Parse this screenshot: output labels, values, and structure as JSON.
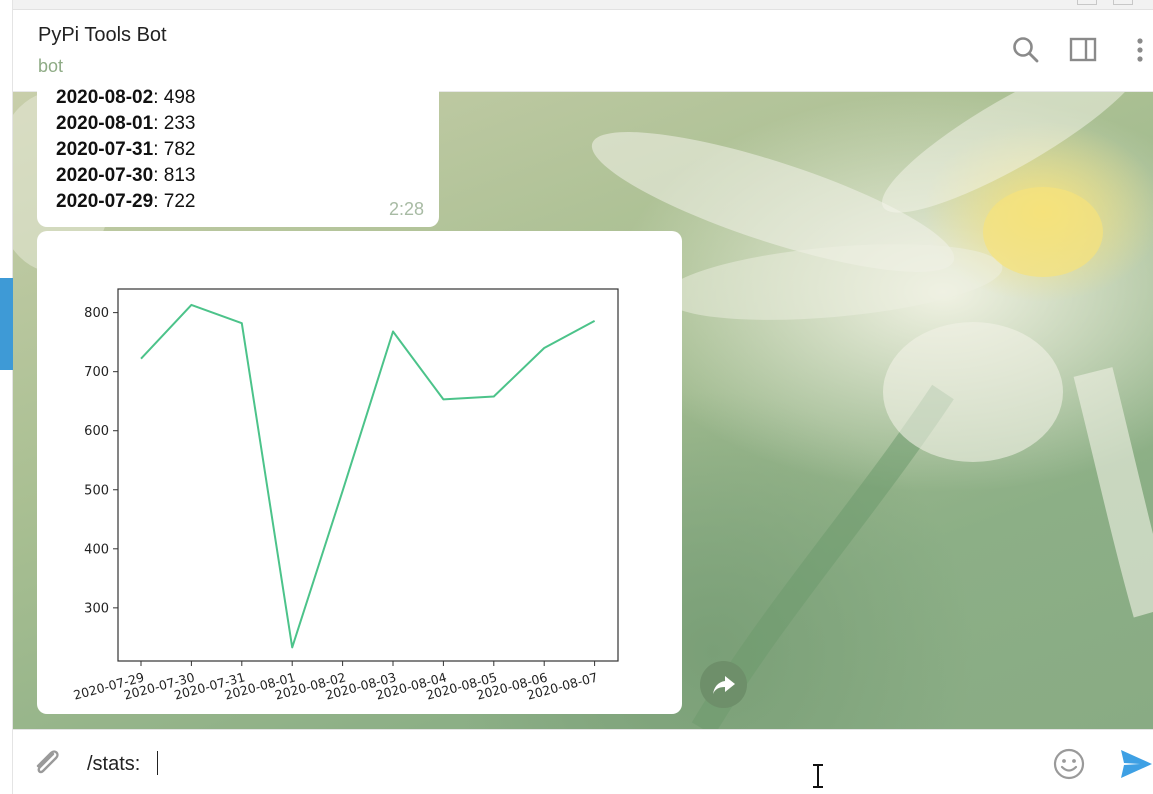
{
  "header": {
    "title": "PyPi Tools Bot",
    "subtitle": "bot",
    "icons": [
      "search-icon",
      "sidebar-toggle-icon",
      "more-vertical-icon"
    ]
  },
  "stats_message": {
    "lines": [
      {
        "date": "2020-08-02",
        "value": ": 498"
      },
      {
        "date": "2020-08-01",
        "value": ": 233"
      },
      {
        "date": "2020-07-31",
        "value": ": 782"
      },
      {
        "date": "2020-07-30",
        "value": ": 813"
      },
      {
        "date": "2020-07-29",
        "value": ": 722"
      }
    ],
    "time": "2:28"
  },
  "chart_data": {
    "type": "line",
    "x": [
      "2020-07-29",
      "2020-07-30",
      "2020-07-31",
      "2020-08-01",
      "2020-08-02",
      "2020-08-03",
      "2020-08-04",
      "2020-08-05",
      "2020-08-06",
      "2020-08-07"
    ],
    "series": [
      {
        "values": [
          722,
          813,
          782,
          233,
          498,
          768,
          653,
          658,
          740,
          786
        ]
      }
    ],
    "yticks": [
      300,
      400,
      500,
      600,
      700,
      800
    ],
    "ylim": [
      210,
      840
    ],
    "title": "",
    "xlabel": "",
    "ylabel": "",
    "line_color": "#4cc38a",
    "grid": false
  },
  "compose": {
    "value": "/stats:",
    "icons": [
      "paperclip-icon",
      "emoji-icon",
      "send-icon"
    ]
  },
  "colors": {
    "accent": "#3e9ad6",
    "subtitle": "#8eab85",
    "send": "#3ea0e4"
  }
}
